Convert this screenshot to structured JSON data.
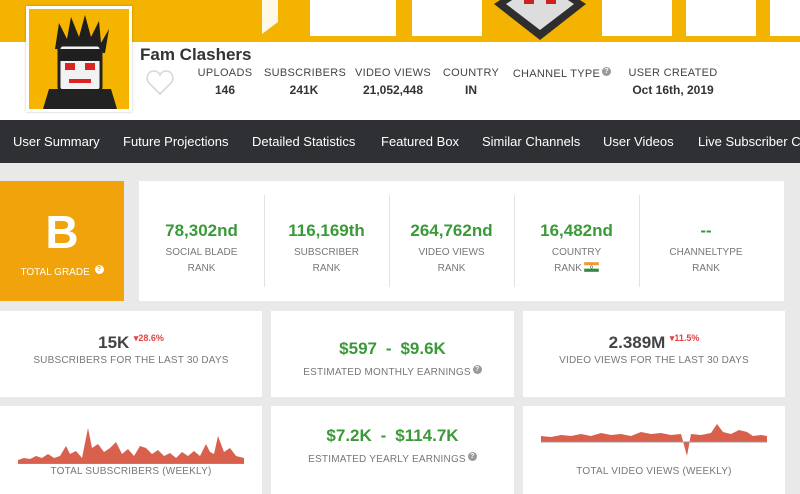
{
  "channel": {
    "name": "Fam Clashers"
  },
  "header_stats": [
    {
      "label": "UPLOADS",
      "value": "146"
    },
    {
      "label": "SUBSCRIBERS",
      "value": "241K"
    },
    {
      "label": "VIDEO VIEWS",
      "value": "21,052,448"
    },
    {
      "label": "COUNTRY",
      "value": "IN"
    },
    {
      "label": "CHANNEL TYPE",
      "value": ""
    },
    {
      "label": "USER CREATED",
      "value": "Oct 16th, 2019"
    }
  ],
  "nav": [
    "User Summary",
    "Future Projections",
    "Detailed Statistics",
    "Featured Box",
    "Similar Channels",
    "User Videos",
    "Live Subscriber Co"
  ],
  "grade": {
    "letter": "B",
    "caption": "TOTAL GRADE"
  },
  "ranks": [
    {
      "value": "78,302nd",
      "line1": "SOCIAL BLADE",
      "line2": "RANK"
    },
    {
      "value": "116,169th",
      "line1": "SUBSCRIBER",
      "line2": "RANK"
    },
    {
      "value": "264,762nd",
      "line1": "VIDEO VIEWS",
      "line2": "RANK"
    },
    {
      "value": "16,482nd",
      "line1": "COUNTRY",
      "line2": "RANK"
    },
    {
      "value": "--",
      "line1": "CHANNELTYPE",
      "line2": "RANK"
    }
  ],
  "summary": {
    "subs_30": {
      "value": "15K",
      "change": "28.6%",
      "caption": "SUBSCRIBERS FOR THE LAST 30 DAYS"
    },
    "monthly": {
      "low": "$597",
      "sep": "-",
      "high": "$9.6K",
      "caption": "ESTIMATED MONTHLY EARNINGS"
    },
    "views_30": {
      "value": "2.389M",
      "change": "11.5%",
      "caption": "VIDEO VIEWS FOR THE LAST 30 DAYS"
    },
    "subs_weekly": {
      "caption": "TOTAL SUBSCRIBERS (WEEKLY)"
    },
    "yearly": {
      "low": "$7.2K",
      "sep": "-",
      "high": "$114.7K",
      "caption": "ESTIMATED YEARLY EARNINGS"
    },
    "views_weekly": {
      "caption": "TOTAL VIDEO VIEWS (WEEKLY)"
    }
  },
  "colors": {
    "banner": "#f4b300",
    "nav_bg": "#2e3033",
    "grade": "#f0a30a",
    "rank_green": "#3a9a38",
    "change_red": "#e04444",
    "sparkline": "#d9604c"
  }
}
